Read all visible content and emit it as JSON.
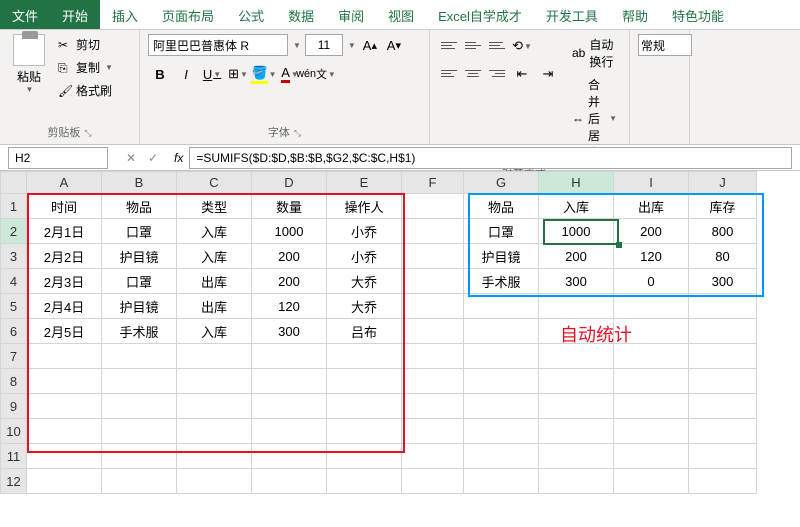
{
  "tabs": [
    "文件",
    "开始",
    "插入",
    "页面布局",
    "公式",
    "数据",
    "审阅",
    "视图",
    "Excel自学成才",
    "开发工具",
    "帮助",
    "特色功能"
  ],
  "clipboard": {
    "paste": "粘贴",
    "cut": "剪切",
    "copy": "复制",
    "format_painter": "格式刷",
    "label": "剪贴板"
  },
  "font": {
    "name": "阿里巴巴普惠体 R",
    "size": "11",
    "label": "字体"
  },
  "align": {
    "wrap": "自动换行",
    "merge": "合并后居中",
    "label": "对齐方式"
  },
  "number_format": "常规",
  "namebox": "H2",
  "formula": "=SUMIFS($D:$D,$B:$B,$G2,$C:$C,H$1)",
  "cols": [
    "A",
    "B",
    "C",
    "D",
    "E",
    "F",
    "G",
    "H",
    "I",
    "J"
  ],
  "rows": [
    "1",
    "2",
    "3",
    "4",
    "5",
    "6",
    "7",
    "8",
    "9",
    "10",
    "11",
    "12"
  ],
  "left_head": [
    "时间",
    "物品",
    "类型",
    "数量",
    "操作人"
  ],
  "left_rows": [
    [
      "2月1日",
      "口罩",
      "入库",
      "1000",
      "小乔"
    ],
    [
      "2月2日",
      "护目镜",
      "入库",
      "200",
      "小乔"
    ],
    [
      "2月3日",
      "口罩",
      "出库",
      "200",
      "大乔"
    ],
    [
      "2月4日",
      "护目镜",
      "出库",
      "120",
      "大乔"
    ],
    [
      "2月5日",
      "手术服",
      "入库",
      "300",
      "吕布"
    ]
  ],
  "right_head": [
    "物品",
    "入库",
    "出库",
    "库存"
  ],
  "right_rows": [
    [
      "口罩",
      "1000",
      "200",
      "800"
    ],
    [
      "护目镜",
      "200",
      "120",
      "80"
    ],
    [
      "手术服",
      "300",
      "0",
      "300"
    ]
  ],
  "auto_stat": "自动统计"
}
